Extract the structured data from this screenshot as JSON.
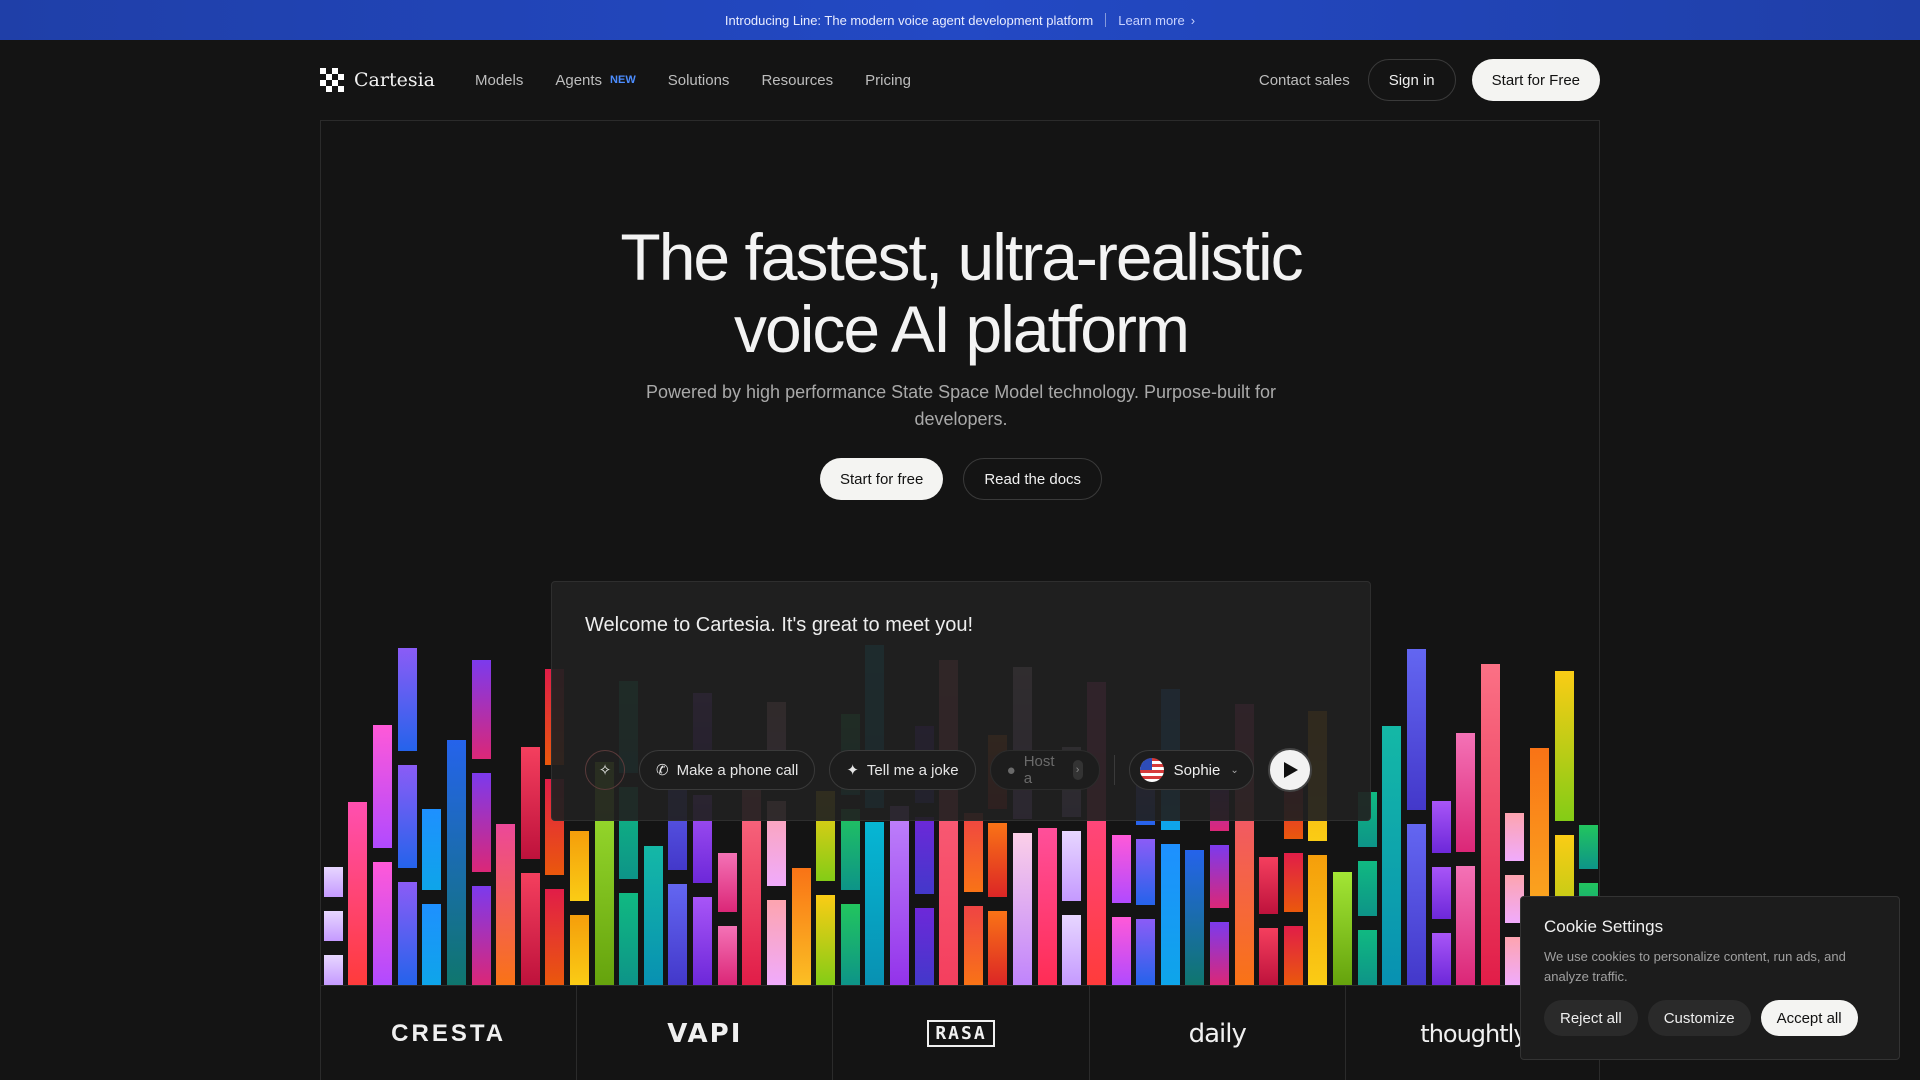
{
  "announcement": {
    "text": "Introducing Line: The modern voice agent development platform",
    "link": "Learn more"
  },
  "nav": {
    "brand": "Cartesia",
    "links": [
      {
        "label": "Models"
      },
      {
        "label": "Agents",
        "badge": "NEW"
      },
      {
        "label": "Solutions"
      },
      {
        "label": "Resources"
      },
      {
        "label": "Pricing"
      }
    ],
    "contact": "Contact sales",
    "sign_in": "Sign in",
    "start": "Start for Free"
  },
  "hero": {
    "title_line1": "The fastest, ultra-realistic",
    "title_line2": "voice AI platform",
    "subtitle": "Powered by high performance State Space Model technology. Purpose-built for developers.",
    "cta_primary": "Start for free",
    "cta_secondary": "Read the docs"
  },
  "demo": {
    "text": "Welcome to Cartesia. It's great to meet you!",
    "chips": [
      "Make a phone call",
      "Tell me a joke",
      "Host a"
    ],
    "voice": "Sophie",
    "icons": {
      "magic": "magic-wand-icon",
      "phone": "phone-icon",
      "joke": "party-popper-icon",
      "mic": "microphone-icon",
      "play": "play-icon",
      "flag": "us-flag-icon"
    }
  },
  "logos": [
    "CRESTA",
    "VAPI",
    "RASA",
    "daily",
    "thoughtly"
  ],
  "cookie": {
    "title": "Cookie Settings",
    "text": "We use cookies to personalize content, run ads, and analyze traffic.",
    "reject": "Reject all",
    "customize": "Customize",
    "accept": "Accept all"
  },
  "colors": {
    "announcement_bg": "#2349c4",
    "page_bg": "#141414",
    "accent_badge": "#4c8dff"
  }
}
